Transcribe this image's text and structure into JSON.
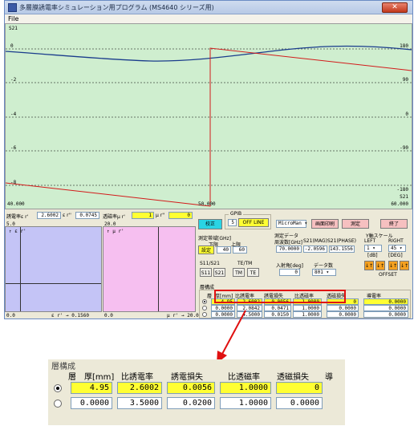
{
  "window": {
    "title": "多層膜誘電率シミュレーション用プログラム (MS4640 シリーズ用)",
    "close_label": "✕"
  },
  "menu": {
    "file": "File"
  },
  "graph": {
    "title": "S21",
    "left_ticks": [
      "0",
      "-2",
      "-4",
      "-6",
      "-8"
    ],
    "right_ticks": [
      "180",
      "90",
      "0",
      "-90",
      "-180"
    ],
    "right_unit": "S21",
    "x_ticks": [
      "40.000",
      "50.000",
      "60.000"
    ]
  },
  "params": {
    "er_label": "誘電率ε r'",
    "er_value": "2.6002",
    "er2_label": "ε r''",
    "er2_value": "0.0745",
    "mu_label": "透磁率μ r'",
    "mu_value": "1",
    "mu2_label": "μ r''",
    "mu2_value": "0"
  },
  "subplots": {
    "left": {
      "top_left": "5.0",
      "title": "↑ ε r'",
      "bottom_left": "0.0",
      "axis": "ε r' → 0.1560"
    },
    "right": {
      "top_left": "20.0",
      "title": "↑ μ r'",
      "bottom_left": "0.0",
      "axis": "μ r' → 20.0",
      "mid_bottom": "0.0"
    }
  },
  "controls": {
    "calibrate": "校正",
    "gpib_caption": "GPIB",
    "gpib_value": "5",
    "offline": "OFF LINE",
    "model_select": "MicroMan ▾",
    "screen_print": "画面印刷",
    "measure": "測定",
    "exit": "終了",
    "band_caption": "測定帯域[GHz]",
    "lower_label": "下限",
    "upper_label": "上限",
    "lower_value": "40",
    "upper_value": "60",
    "set_button": "設定",
    "data_caption": "測定データ",
    "freq_label": "周波数[GHz]",
    "mag_label": "S21(MAG)",
    "phase_label": "S21(PHASE)",
    "freq_value": "70.0000",
    "mag_value": "-2.0596",
    "phase_value": "143.1556",
    "scale_caption": "Y軸スケール",
    "left_label": "LEFT",
    "right_label": "RIGHT",
    "left_value": "1 ▾",
    "right_value": "45 ▾",
    "db_label": "[dB]",
    "deg_label": "[DEG]",
    "offset_label": "OFFSET",
    "arrows": [
      "↓↑",
      "↓↑"
    ],
    "s_caption": "S11/S21",
    "s11": "S11",
    "s21": "S21",
    "tetm_caption": "TE/TM",
    "tm": "TM",
    "te": "TE",
    "angle_caption": "入射角[deg]",
    "angle_value": "0",
    "points_caption": "データ数",
    "points_value": "801 ▾"
  },
  "layers": {
    "caption": "層構成",
    "headers": [
      "層",
      "厚[mm]",
      "比誘電率",
      "誘電損失",
      "比透磁率",
      "透磁損失",
      "導電率"
    ],
    "rows": [
      {
        "selected": true,
        "values": [
          "4.95",
          "2.6002",
          "0.0056",
          "1.0000",
          "0",
          "0.0000"
        ]
      },
      {
        "selected": false,
        "values": [
          "0.0000",
          "3.5000",
          "0.0200",
          "1.0000",
          "0.0000",
          "0.0000"
        ]
      },
      {
        "selected": false,
        "values": [
          "0.0000",
          "2.0842",
          "0.0471",
          "1.0000",
          "0.0000",
          "0.0000"
        ]
      },
      {
        "selected": false,
        "values": [
          "0.0000",
          "4.5000",
          "0.0150",
          "1.0000",
          "0.0000",
          "0.0000"
        ]
      }
    ]
  },
  "zoom": {
    "caption": "層構成",
    "headers": [
      "層",
      "厚[mm]",
      "比誘電率",
      "誘電損失",
      "比透磁率",
      "透磁損失",
      "導"
    ],
    "rows": [
      {
        "selected": true,
        "values": [
          "4.95",
          "2.6002",
          "0.0056",
          "1.0000",
          "0"
        ]
      },
      {
        "selected": false,
        "values": [
          "0.0000",
          "3.5000",
          "0.0200",
          "1.0000",
          "0.0000"
        ]
      }
    ]
  },
  "colors": {
    "highlight": "#e01010",
    "graph_bg": "#cfeecf",
    "blue_curve": "#1a3c8c",
    "red_curve": "#d21a1a"
  }
}
